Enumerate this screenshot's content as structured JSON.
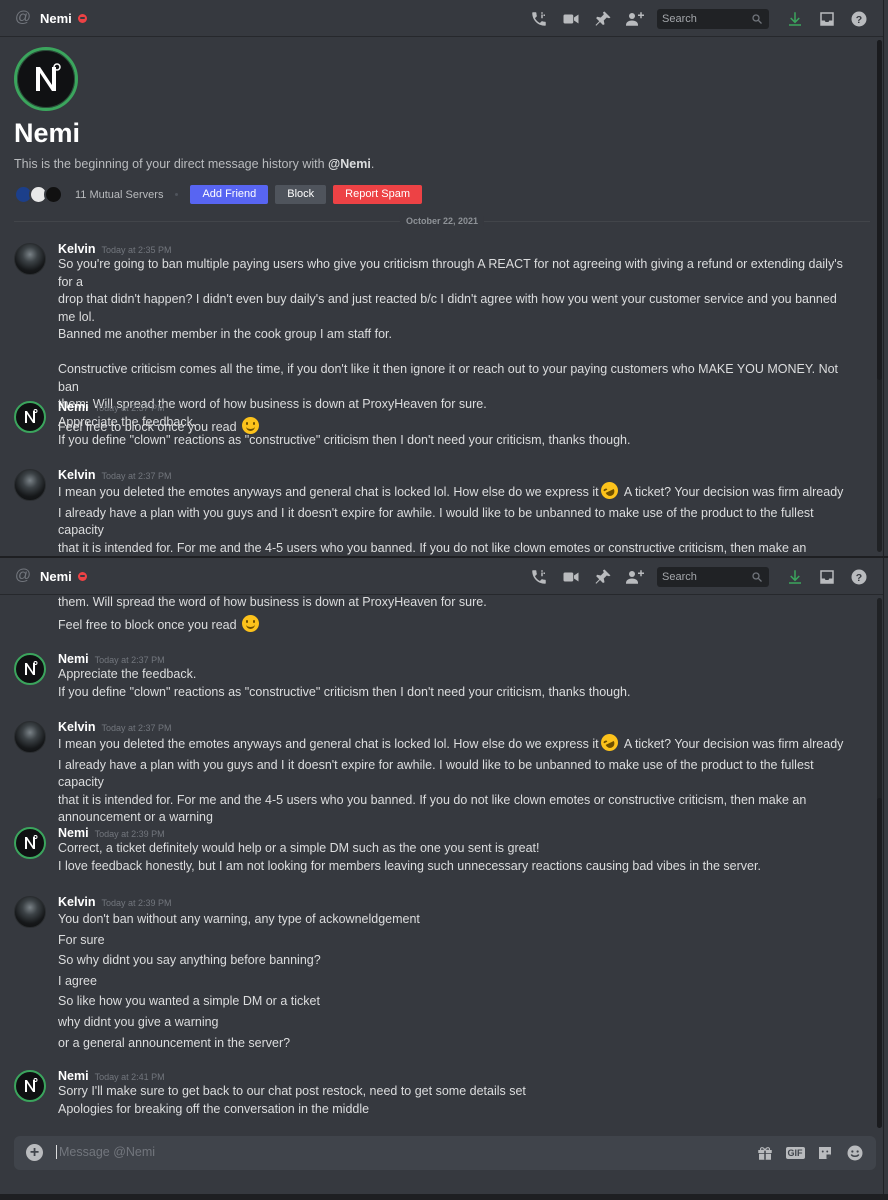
{
  "header": {
    "name": "Nemi",
    "search_placeholder": "Search"
  },
  "intro": {
    "name": "Nemi",
    "text_prefix": "This is the beginning of your direct message history with ",
    "text_handle": "@Nemi",
    "text_suffix": ".",
    "mutual_servers": "11 Mutual Servers",
    "add_friend": "Add Friend",
    "block": "Block",
    "report_spam": "Report Spam"
  },
  "date_divider": "October 22, 2021",
  "composer": {
    "placeholder": "Message @Nemi",
    "gif_label": "GIF"
  },
  "messages": [
    {
      "author": "Kelvin",
      "timestamp": "Today at 2:35 PM",
      "lines": [
        "So you're going to ban multiple paying users who give you criticism through A REACT for not agreeing with giving a refund or extending daily's for a",
        "drop that didn't happen? I didn't even buy daily's and just reacted b/c I didn't agree with how you went your customer service and you banned me lol.",
        "Banned me another member in the cook group I am staff for.",
        "Constructive criticism comes all the time, if you don't like it then ignore it or reach out to your paying customers who MAKE YOU MONEY. Not ban",
        "them. Will spread the word of how business is down at ProxyHeaven for sure.",
        "Feel free to block once you read"
      ]
    },
    {
      "author": "Nemi",
      "timestamp": "Today at 2:37 PM",
      "lines": [
        "Appreciate the feedback.",
        "If you define \"clown\" reactions as \"constructive\" criticism then I don't need your criticism, thanks though."
      ]
    },
    {
      "author": "Kelvin",
      "timestamp": "Today at 2:37 PM",
      "lines": [
        "I mean you deleted the emotes anyways and general chat is locked lol. How else do we express it",
        "A ticket? Your decision was firm already",
        "I already have a plan with you guys and I it doesn't expire for awhile. I would like to be unbanned to make use of the product to the fullest capacity",
        "that it is intended for. For me and the 4-5 users who you banned. If you do not like clown emotes or constructive criticism, then make an",
        "announcement or a warning"
      ]
    },
    {
      "author": "Nemi",
      "timestamp": "Today at 2:39 PM",
      "lines": [
        "Correct, a ticket definitely would help or a simple DM such as the one you sent is great!",
        "I love feedback honestly, but I am not looking for members leaving such unnecessary reactions causing bad vibes in the server."
      ]
    },
    {
      "author": "Kelvin",
      "timestamp": "Today at 2:39 PM",
      "lines": [
        "You don't ban without any warning, any type of ackowneldgement",
        "For sure",
        "So why didnt you say anything before banning?",
        "I agree",
        "So like how you wanted a simple DM or a ticket",
        "why didnt you give a warning",
        "or a general announcement in the server?"
      ]
    },
    {
      "author": "Nemi",
      "timestamp": "Today at 2:41 PM",
      "lines": [
        "Sorry I'll make sure to  get back to our chat post restock, need to get some details set",
        "Apologies for breaking off the conversation in the middle"
      ]
    }
  ]
}
